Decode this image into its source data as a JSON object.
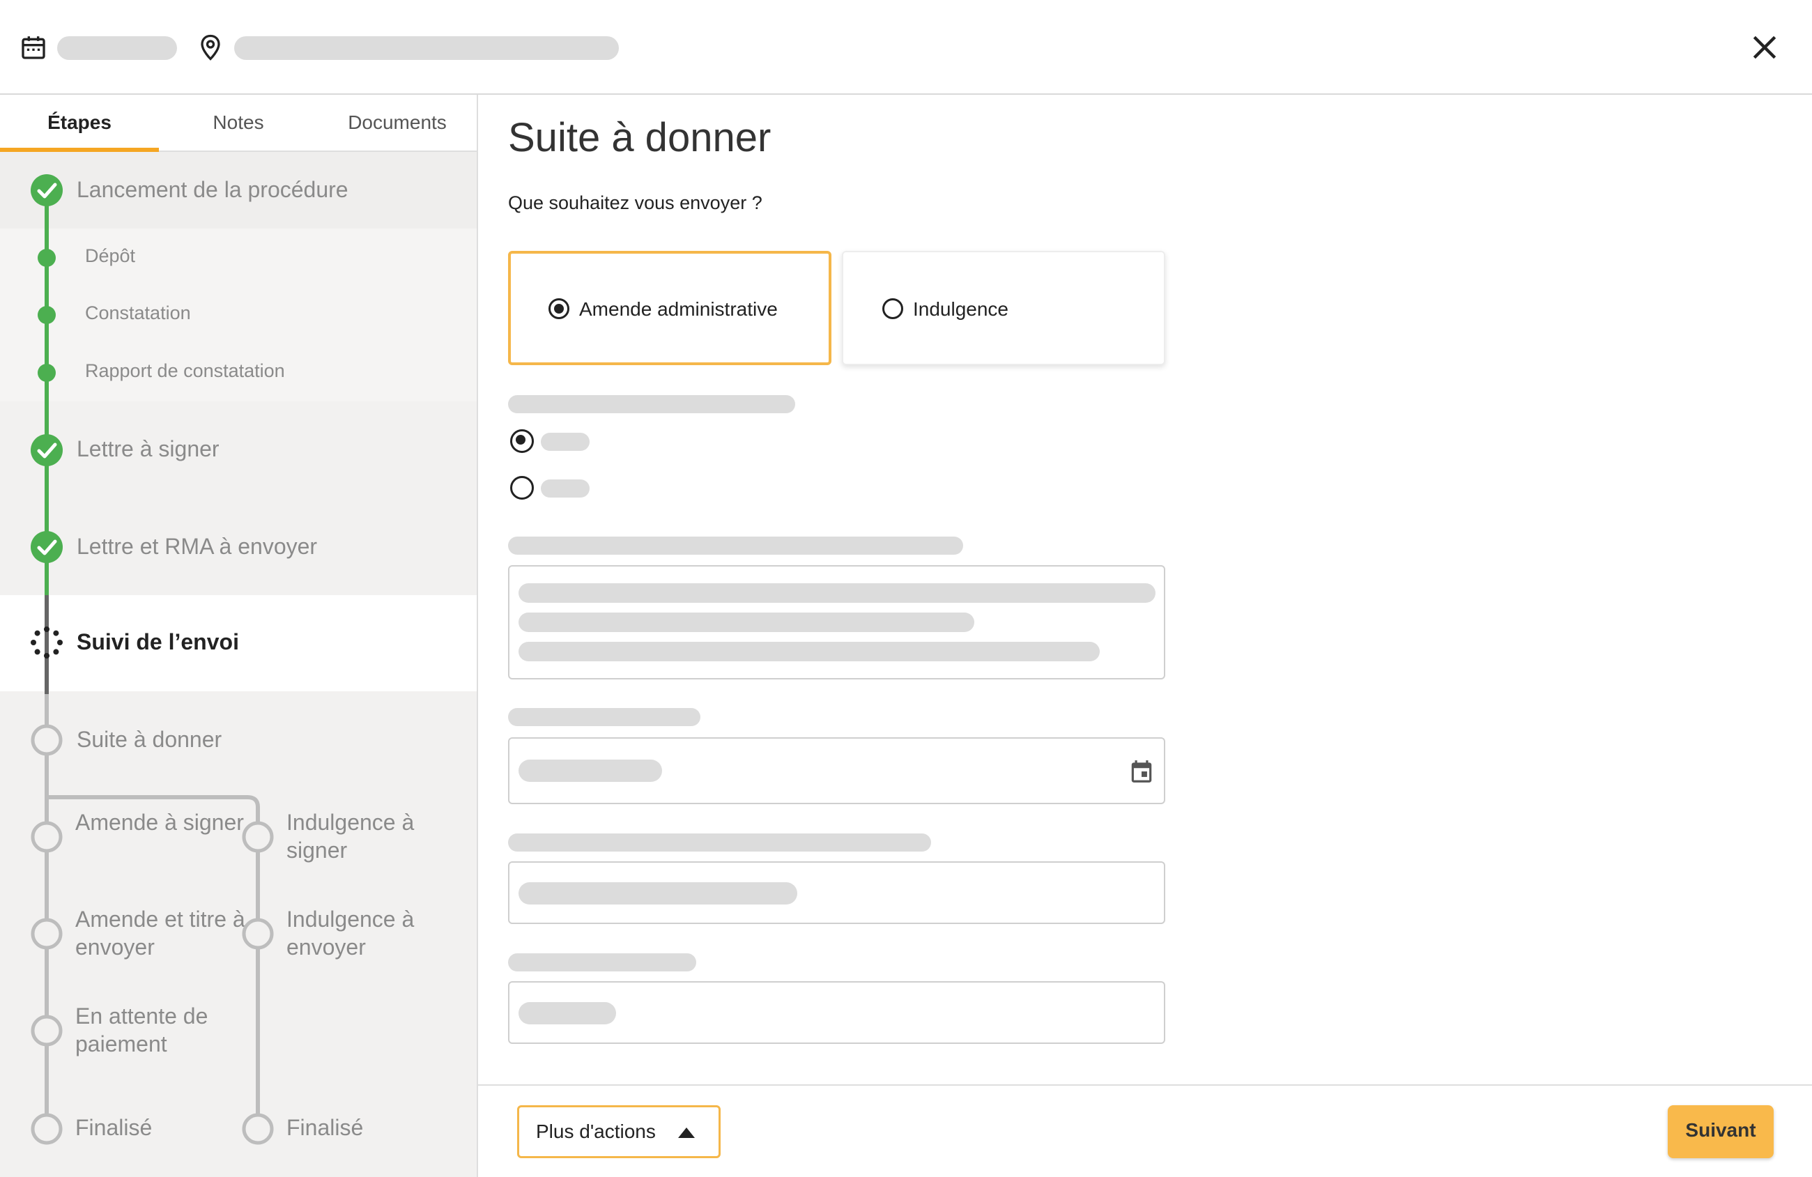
{
  "colors": {
    "accent": "#f5a623",
    "success": "#4caf50",
    "sidebar_bg": "#f2f1f0",
    "button_primary": "#f9b94b"
  },
  "header": {
    "calendar_icon": "calendar-icon",
    "location_icon": "location-pin-icon",
    "close_icon": "close-icon"
  },
  "tabs": [
    {
      "label": "Étapes",
      "active": true
    },
    {
      "label": "Notes",
      "active": false
    },
    {
      "label": "Documents",
      "active": false
    }
  ],
  "steps": {
    "lancement": "Lancement de la procédure",
    "sub": [
      "Dépôt",
      "Constatation",
      "Rapport de constatation"
    ],
    "lettre_signer": "Lettre à signer",
    "lettre_rma": "Lettre et RMA à envoyer",
    "suivi": "Suivi de l’envoi",
    "suite": "Suite à donner",
    "branch_left": [
      "Amende à signer",
      "Amende et titre à envoyer",
      "En attente de paiement",
      "Finalisé"
    ],
    "branch_right": [
      "Indulgence à signer",
      "Indulgence à envoyer",
      "Finalisé"
    ]
  },
  "main": {
    "title": "Suite à donner",
    "question": "Que souhaitez vous envoyer ?",
    "options": [
      {
        "label": "Amende administrative",
        "selected": true
      },
      {
        "label": "Indulgence",
        "selected": false
      }
    ],
    "date_icon": "calendar-icon"
  },
  "footer": {
    "more_actions": "Plus d'actions",
    "next": "Suivant"
  }
}
